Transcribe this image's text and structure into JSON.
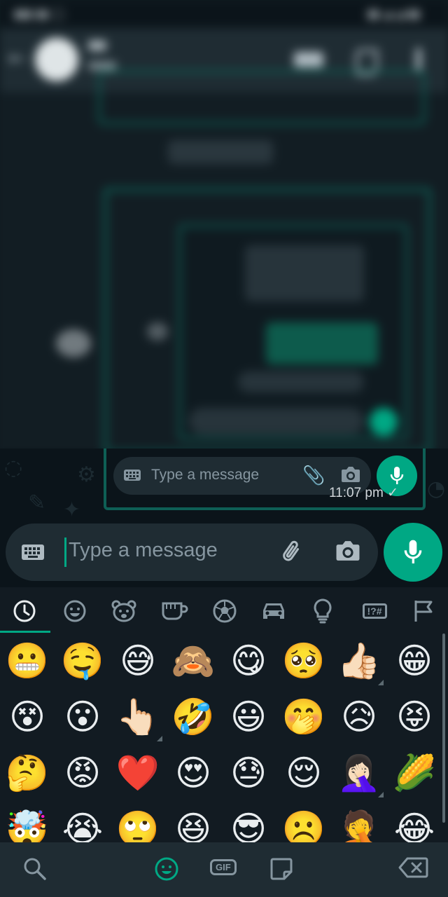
{
  "input": {
    "placeholder": "Type a message"
  },
  "embedded_screenshot": {
    "placeholder": "Type a message",
    "time": "11:07 pm",
    "tick": "✓"
  },
  "emoji_categories": [
    {
      "name": "recent-icon"
    },
    {
      "name": "smileys-icon"
    },
    {
      "name": "animals-icon"
    },
    {
      "name": "food-icon"
    },
    {
      "name": "activity-icon"
    },
    {
      "name": "travel-icon"
    },
    {
      "name": "objects-icon"
    },
    {
      "name": "symbols-icon"
    },
    {
      "name": "flags-icon"
    }
  ],
  "symbols_label": "!?#",
  "emojis": [
    [
      "😬",
      "🤤",
      "😅",
      "🙈",
      "😋",
      "🥺",
      "👍🏻",
      "😁"
    ],
    [
      "😵",
      "😮",
      "👆🏻",
      "🤣",
      "😃",
      "🤭",
      "😥",
      "😝"
    ],
    [
      "🤔",
      "😡",
      "❤️",
      "😍",
      "😓",
      "😌",
      "🤦🏻‍♀️",
      "🌽"
    ],
    [
      "🤯",
      "😭",
      "🙄",
      "😆",
      "😎",
      "☹️",
      "🤦",
      "😂"
    ]
  ],
  "bottom_bar": {
    "gif_label": "GIF"
  },
  "colors": {
    "accent": "#00a884",
    "panel": "#121b22",
    "input": "#1f2c33"
  }
}
